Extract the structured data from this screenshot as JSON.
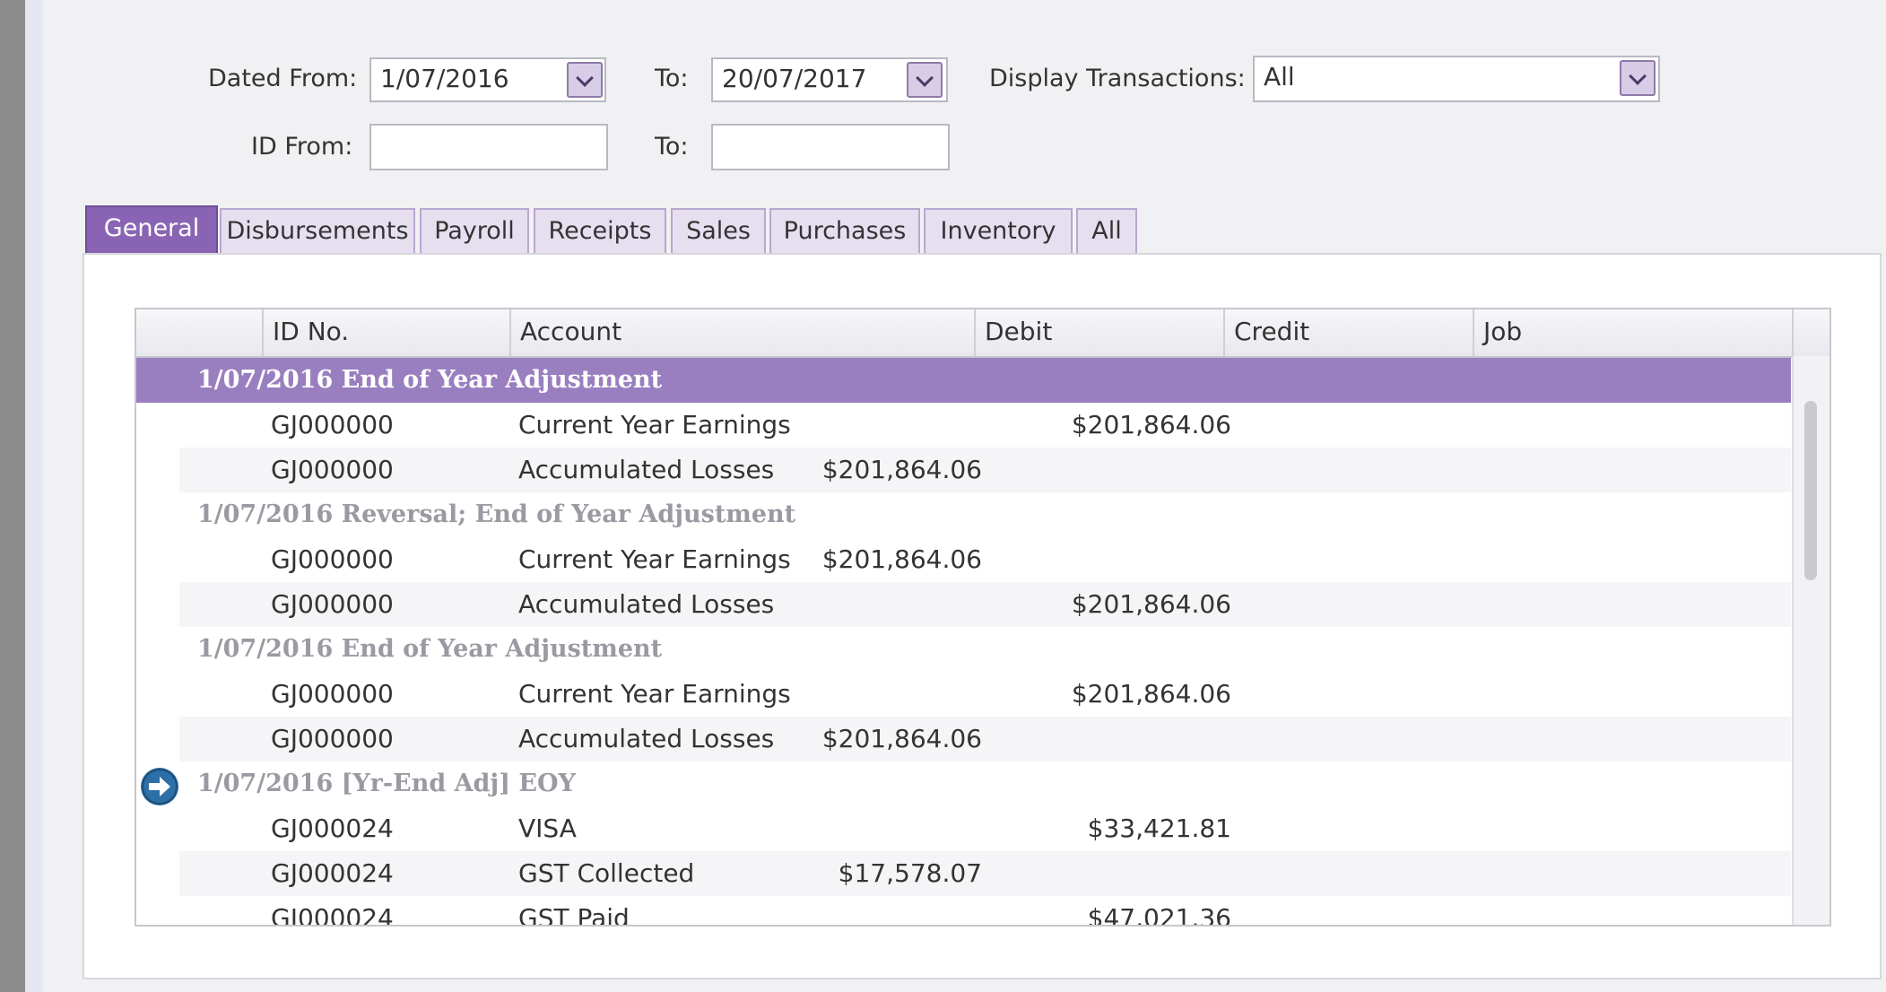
{
  "filters": {
    "dated_from_label": "Dated From:",
    "dated_from_value": "1/07/2016",
    "to_label": "To:",
    "to_value": "20/07/2017",
    "display_label": "Display Transactions:",
    "display_value": "All",
    "id_from_label": "ID From:",
    "id_from_value": "",
    "id_to_label": "To:",
    "id_to_value": ""
  },
  "tabs": [
    "General",
    "Disbursements",
    "Payroll",
    "Receipts",
    "Sales",
    "Purchases",
    "Inventory",
    "All"
  ],
  "active_tab": "General",
  "columns": [
    "ID No.",
    "Account",
    "Debit",
    "Credit",
    "Job"
  ],
  "groups": [
    {
      "title": "1/07/2016  End of Year Adjustment",
      "rows": [
        {
          "id": "GJ000000",
          "account": "Current Year Earnings",
          "debit": "",
          "credit": "$201,864.06",
          "job": ""
        },
        {
          "id": "GJ000000",
          "account": "Accumulated Losses",
          "debit": "$201,864.06",
          "credit": "",
          "job": ""
        }
      ]
    },
    {
      "title": "1/07/2016  Reversal; End of Year Adjustment",
      "rows": [
        {
          "id": "GJ000000",
          "account": "Current Year Earnings",
          "debit": "$201,864.06",
          "credit": "",
          "job": ""
        },
        {
          "id": "GJ000000",
          "account": "Accumulated Losses",
          "debit": "",
          "credit": "$201,864.06",
          "job": ""
        }
      ]
    },
    {
      "title": "1/07/2016  End of Year Adjustment",
      "rows": [
        {
          "id": "GJ000000",
          "account": "Current Year Earnings",
          "debit": "",
          "credit": "$201,864.06",
          "job": ""
        },
        {
          "id": "GJ000000",
          "account": "Accumulated Losses",
          "debit": "$201,864.06",
          "credit": "",
          "job": ""
        }
      ]
    },
    {
      "title": "1/07/2016  [Yr-End Adj] EOY",
      "rows": [
        {
          "id": "GJ000024",
          "account": "VISA",
          "debit": "",
          "credit": "$33,421.81",
          "job": ""
        },
        {
          "id": "GJ000024",
          "account": "GST Collected",
          "debit": "$17,578.07",
          "credit": "",
          "job": ""
        },
        {
          "id": "GJ000024",
          "account": "GST Paid",
          "debit": "",
          "credit": "$47,021.36",
          "job": ""
        }
      ]
    }
  ],
  "colors": {
    "accent": "#8a64b4",
    "selected_row": "#9a7fc0"
  }
}
